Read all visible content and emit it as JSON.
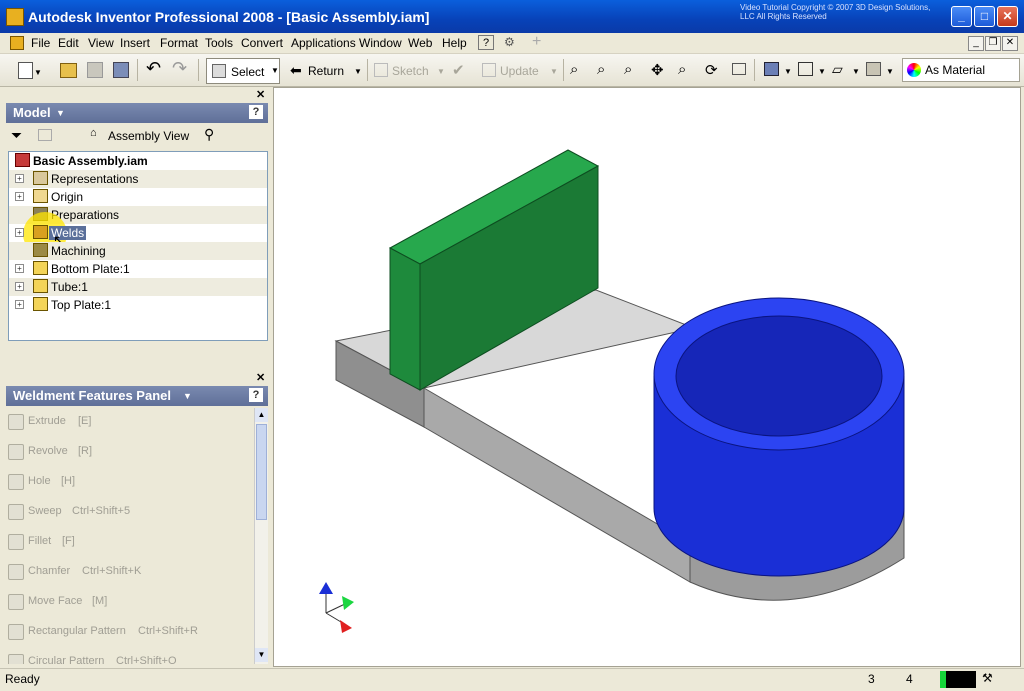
{
  "window": {
    "title": "Autodesk Inventor Professional 2008 - [Basic Assembly.iam]",
    "copyright": "Video Tutorial Copyright © 2007 3D Design Solutions, LLC All Rights Reserved"
  },
  "menu": [
    "File",
    "Edit",
    "View",
    "Insert",
    "Format",
    "Tools",
    "Convert",
    "Applications",
    "Window",
    "Web",
    "Help"
  ],
  "toolbar": {
    "select_label": "Select",
    "return_label": "Return",
    "sketch_label": "Sketch",
    "update_label": "Update",
    "material_value": "As Material"
  },
  "model_panel": {
    "title": "Model",
    "view_label": "Assembly View",
    "root": "Basic Assembly.iam",
    "items": [
      {
        "label": "Representations"
      },
      {
        "label": "Origin"
      },
      {
        "label": "Preparations"
      },
      {
        "label": "Welds"
      },
      {
        "label": "Machining"
      },
      {
        "label": "Bottom Plate:1"
      },
      {
        "label": "Tube:1"
      },
      {
        "label": "Top Plate:1"
      }
    ]
  },
  "weld_panel": {
    "title": "Weldment Features Panel",
    "items": [
      {
        "name": "Extrude",
        "shortcut": "[E]"
      },
      {
        "name": "Revolve",
        "shortcut": "[R]"
      },
      {
        "name": "Hole",
        "shortcut": "[H]"
      },
      {
        "name": "Sweep",
        "shortcut": "Ctrl+Shift+5"
      },
      {
        "name": "Fillet",
        "shortcut": "[F]"
      },
      {
        "name": "Chamfer",
        "shortcut": "Ctrl+Shift+K"
      },
      {
        "name": "Move Face",
        "shortcut": "[M]"
      },
      {
        "name": "Rectangular Pattern",
        "shortcut": "Ctrl+Shift+R"
      },
      {
        "name": "Circular Pattern",
        "shortcut": "Ctrl+Shift+O"
      }
    ]
  },
  "status": {
    "text": "Ready",
    "num1": "3",
    "num2": "4"
  },
  "colors": {
    "plate_green": "#1e8a3c",
    "tube_blue": "#1a2fd6",
    "base_gray": "#d8d8d8"
  }
}
